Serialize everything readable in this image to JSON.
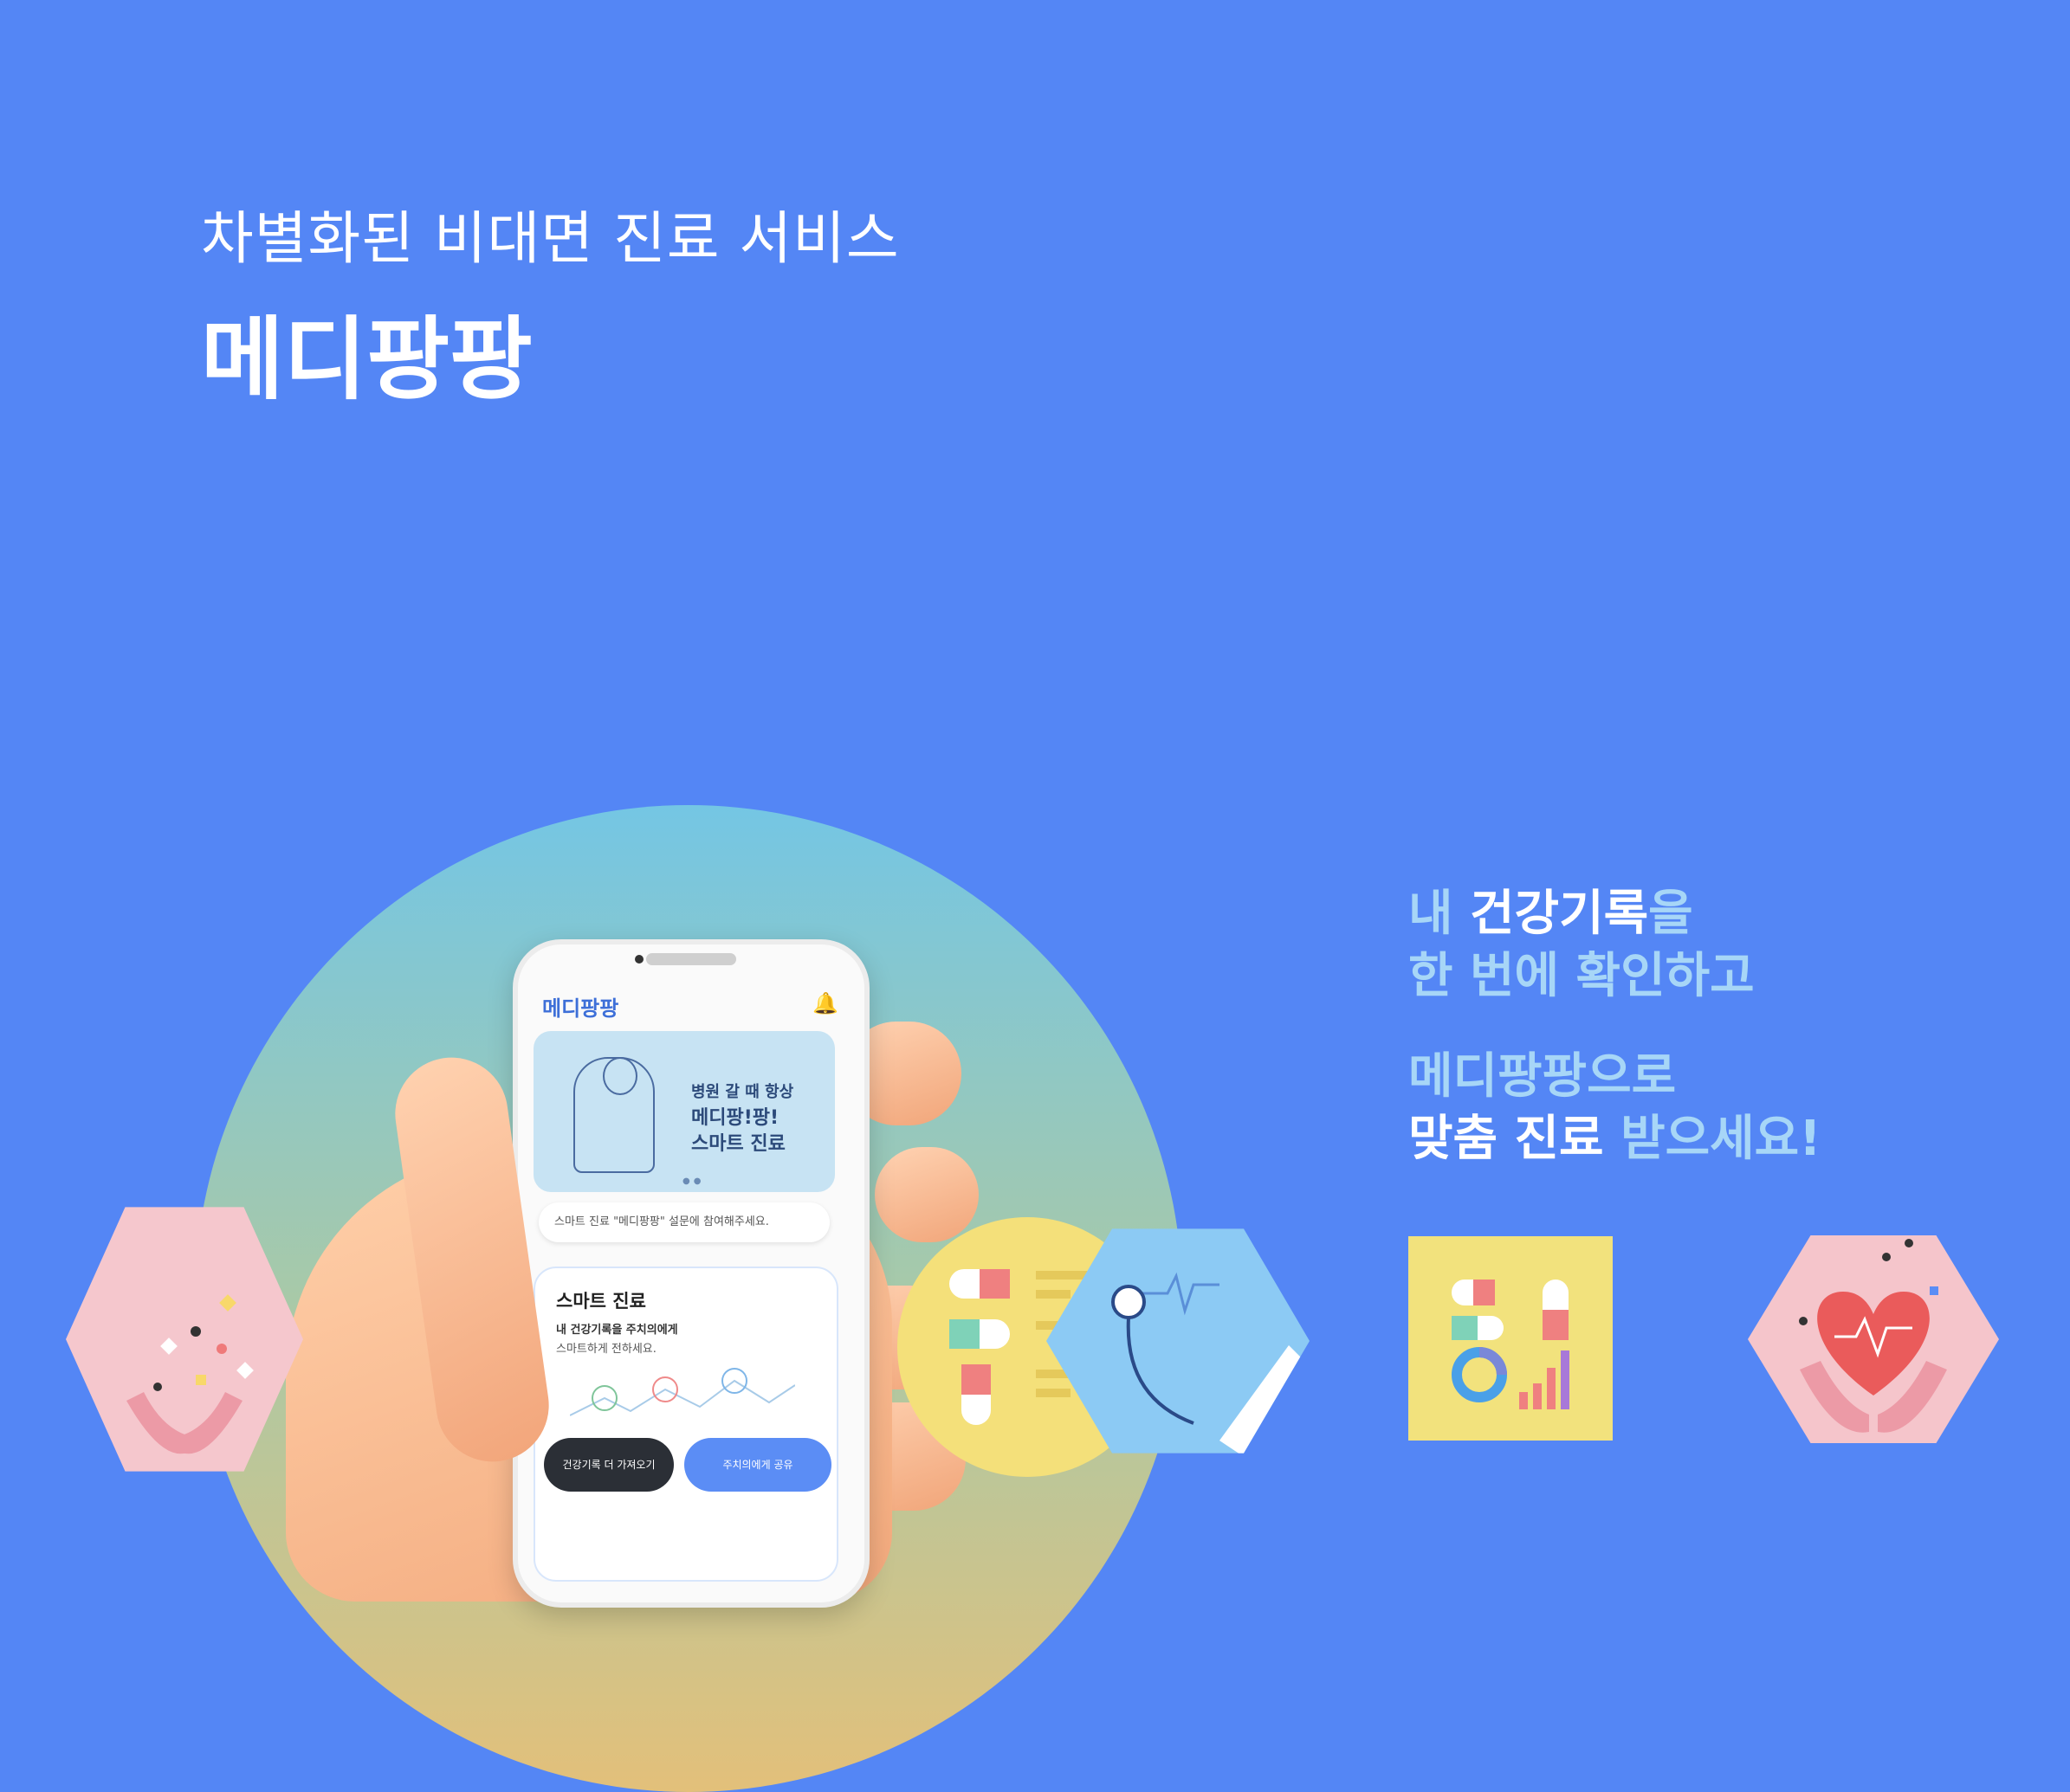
{
  "header": {
    "subtitle": "차별화된 비대면 진료 서비스",
    "title": "메디팡팡"
  },
  "copy": {
    "line1_normal_a": "내 ",
    "line1_bold": "건강기록",
    "line1_normal_b": "을",
    "line2": "한 번에 확인하고",
    "line3": "메디팡팡으로",
    "line4_bold": "맞춤 진료 ",
    "line4_normal": "받으세요!"
  },
  "phone": {
    "app_logo": "메디팡팡",
    "banner_line1": "병원 갈 때 항상",
    "banner_line2": "메디팡!팡!",
    "banner_line3": "스마트 진료",
    "notice": "스마트 진료 \"메디팡팡\" 설문에 참여해주세요.",
    "card_title": "스마트 진료",
    "card_desc1": "내 건강기록을 주치의에게",
    "card_desc2": "스마트하게 전하세요.",
    "button_import": "건강기록 더 가져오기",
    "button_share": "주치의에게 공유"
  },
  "colors": {
    "background": "#5486f5",
    "accent_light": "#a7d6f7",
    "white": "#ffffff"
  }
}
